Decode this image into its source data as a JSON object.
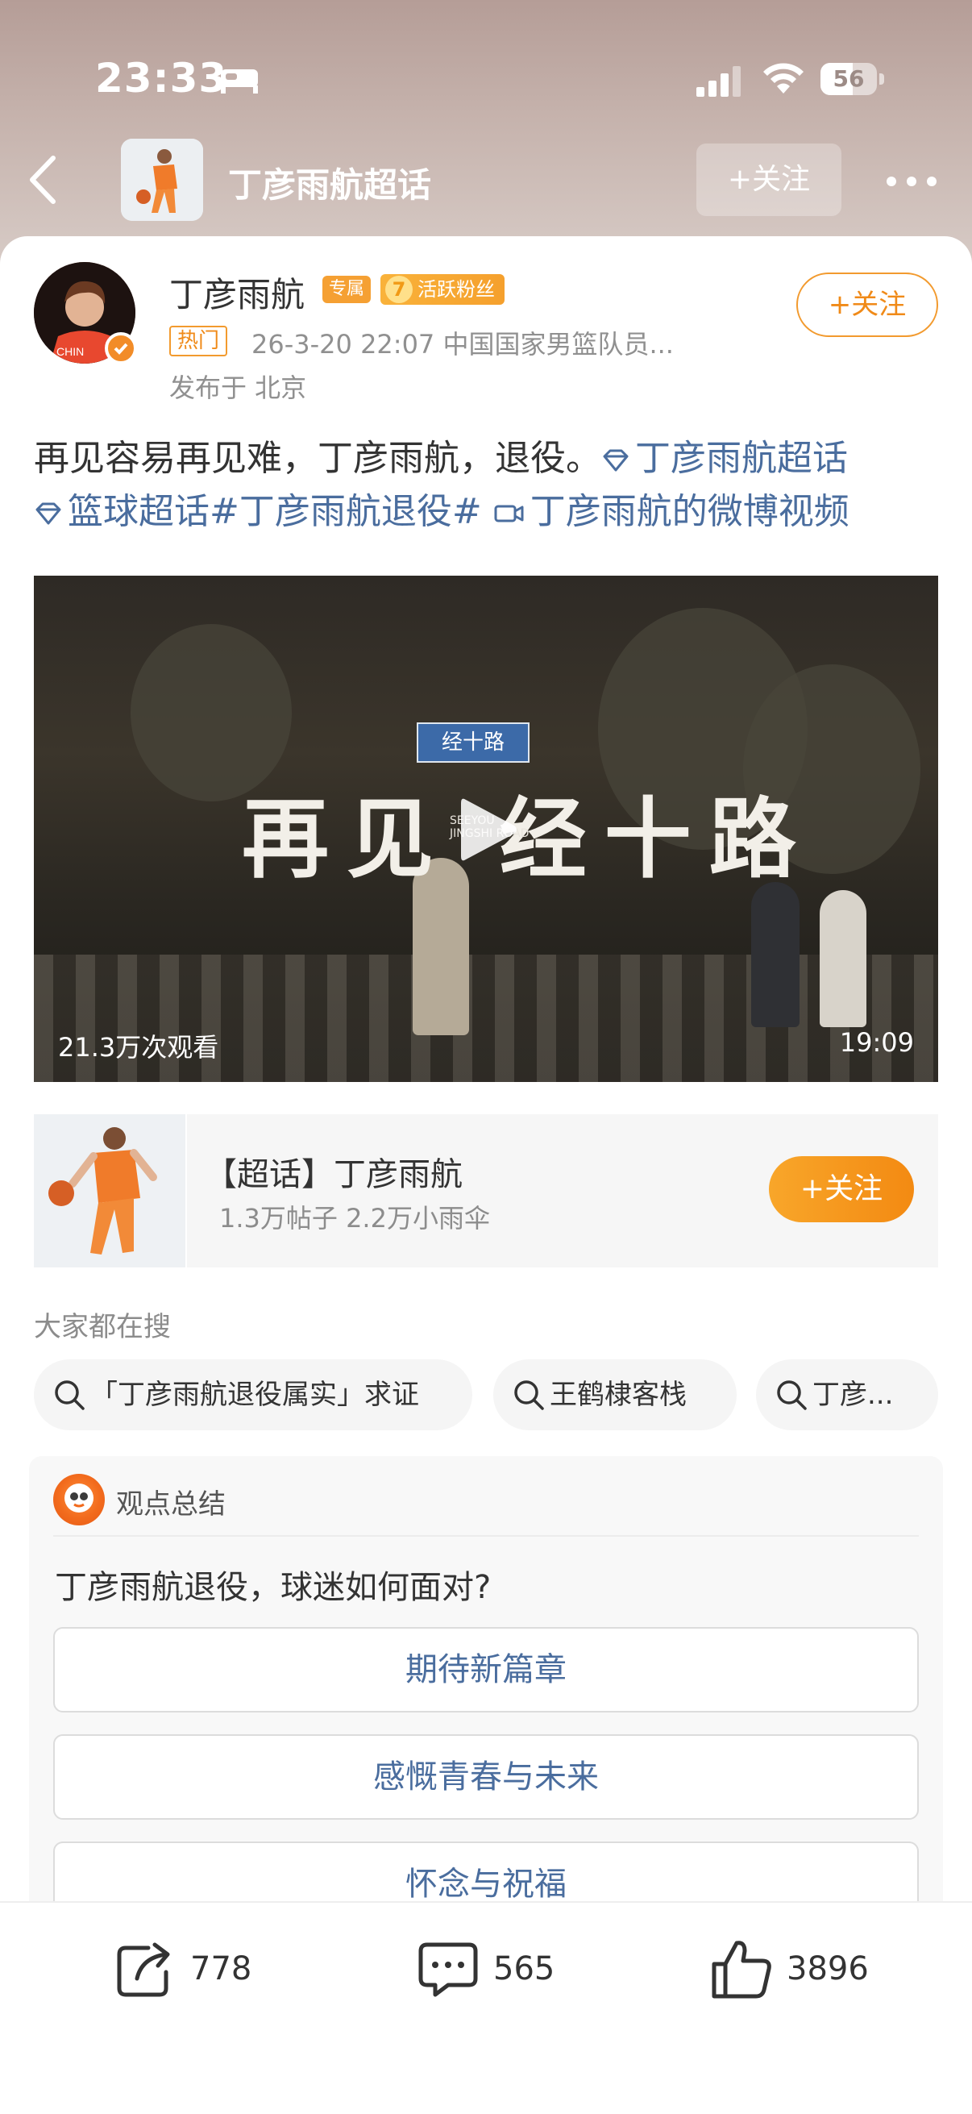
{
  "status_bar": {
    "time": "23:33",
    "battery": "56"
  },
  "nav": {
    "title": "丁彦雨航超话",
    "follow_label": "+关注"
  },
  "post": {
    "author": "丁彦雨航",
    "tag_exclusive": "专属",
    "fan_level": "7",
    "fan_tag": "活跃粉丝",
    "hot_tag": "热门",
    "meta": "26-3-20 22:07  中国国家男篮队员...",
    "location": "发布于 北京",
    "follow_label": "+关注",
    "text_main": "再见容易再见难，丁彦雨航，退役。",
    "link_supertopic": "丁彦雨航超话",
    "link_basketball": "篮球超话",
    "hashtag": "#丁彦雨航退役#",
    "link_video": "丁彦雨航的微博视频"
  },
  "video": {
    "title": "再见 经十路",
    "subtitle_en_1": "SEEYOU",
    "subtitle_en_2": "JINGSHI ROAD",
    "sign": "经十路",
    "views": "21.3万次观看",
    "duration": "19:09"
  },
  "topic_card": {
    "name": "【超话】丁彦雨航",
    "stats": "1.3万帖子  2.2万小雨伞",
    "follow_label": "+关注"
  },
  "searches": {
    "title": "大家都在搜",
    "chips": [
      "「丁彦雨航退役属实」求证",
      "王鹤棣客栈",
      "丁彦..."
    ]
  },
  "summary": {
    "title": "观点总结",
    "question": "丁彦雨航退役，球迷如何面对?",
    "options": [
      "期待新篇章",
      "感慨青春与未来",
      "怀念与祝福"
    ]
  },
  "actions": {
    "share": "778",
    "comment": "565",
    "like": "3896"
  },
  "colors": {
    "accent_orange": "#f29a2e",
    "link_blue": "#4a6d9e"
  }
}
